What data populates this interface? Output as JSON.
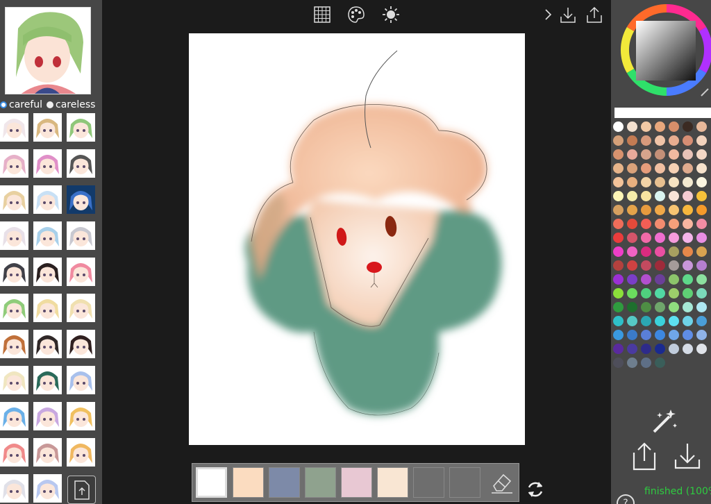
{
  "left_panel": {
    "modes": [
      {
        "label": "careful",
        "selected": true
      },
      {
        "label": "careless",
        "selected": false
      }
    ],
    "reference_count": 33
  },
  "toolbar": {
    "icons": [
      "grid-icon",
      "palette-icon",
      "brightness-icon",
      "chevron-right-icon",
      "download-icon",
      "share-icon"
    ]
  },
  "colors": {
    "panel_bg": "#474747",
    "canvas_bg": "#ffffff",
    "app_bg": "#1b1b1b",
    "status_green": "#2ecc40"
  },
  "swatches": [
    "#ffffff",
    "#fbdcc0",
    "#7d8aa8",
    "#8fa28e",
    "#e8c8d3",
    "#f9e6d3",
    "#6e6e6e",
    "#6e6e6e"
  ],
  "palette_colors": [
    "#ffffff",
    "#f3e1d0",
    "#f2c9a5",
    "#e8a77c",
    "#d88f6a",
    "#3b2a22",
    "#e9b99a",
    "#d4a079",
    "#c37b53",
    "#d79a7c",
    "#f0c4a8",
    "#e8ad90",
    "#d68e74",
    "#f2d2bc",
    "#d8926e",
    "#e8a99a",
    "#d7a48c",
    "#c59078",
    "#f1b9a0",
    "#e9c3b8",
    "#f4d7c5",
    "#e7b48a",
    "#dba27a",
    "#e69c7b",
    "#f1bfa1",
    "#f6d1b4",
    "#e0ab8e",
    "#f7e2cc",
    "#f3c39a",
    "#e9b07f",
    "#f2d3a7",
    "#e8c090",
    "#f6e3c2",
    "#f3e9d0",
    "#fbf5e0",
    "#fdf6b7",
    "#f5ecaa",
    "#f7e3a0",
    "#d9f4f0",
    "#f8e4d8",
    "#f5cbd2",
    "#f7c23a",
    "#d6a060",
    "#e4a34a",
    "#e69a3e",
    "#f0a848",
    "#f7c472",
    "#f7b73d",
    "#f59a2a",
    "#ef6d5a",
    "#e44a3a",
    "#f25e55",
    "#f28b6f",
    "#f5a07a",
    "#f8b6a0",
    "#f28da3",
    "#ea3c3c",
    "#d6556a",
    "#f26aa8",
    "#f06ecf",
    "#f59bdb",
    "#f4b4e9",
    "#e88ee2",
    "#ee3ec7",
    "#f062c4",
    "#d92b7f",
    "#ea4fa2",
    "#a8a060",
    "#e6884a",
    "#d9a350",
    "#b3413e",
    "#cf4242",
    "#c34a5f",
    "#9e2b3a",
    "#a59b9a",
    "#c896d9",
    "#b57fd0",
    "#9b30d5",
    "#7a3ec8",
    "#b24fcf",
    "#6b3f99",
    "#8cc46b",
    "#5ed88a",
    "#8cdf9f",
    "#8be03a",
    "#6bdc5e",
    "#4fd07e",
    "#51d9a3",
    "#9ccd6a",
    "#5fcf75",
    "#7bdaba",
    "#2f9c3f",
    "#1e6f2d",
    "#4e8e44",
    "#6fa66b",
    "#8fdd7e",
    "#a6e8d6",
    "#aee7f1",
    "#2fc0c8",
    "#56c9c5",
    "#2ba7b3",
    "#3bd2da",
    "#5de0f0",
    "#6ed3e8",
    "#4a9ed8",
    "#3a9ae0",
    "#3b7bc8",
    "#5a7fd8",
    "#3d88e0",
    "#6fa6e8",
    "#5f8de6",
    "#8fb3e8",
    "#5a2a9e",
    "#4a3aa0",
    "#2e2b8a",
    "#1a2a8f",
    "#c0ccdc",
    "#d4dbe6",
    "#dfe3e9",
    "#4e4e5a",
    "#6e7e8e",
    "#5e6f86",
    "#3a5e5a"
  ],
  "status": {
    "text": "finished (100%"
  },
  "help_label": "?"
}
